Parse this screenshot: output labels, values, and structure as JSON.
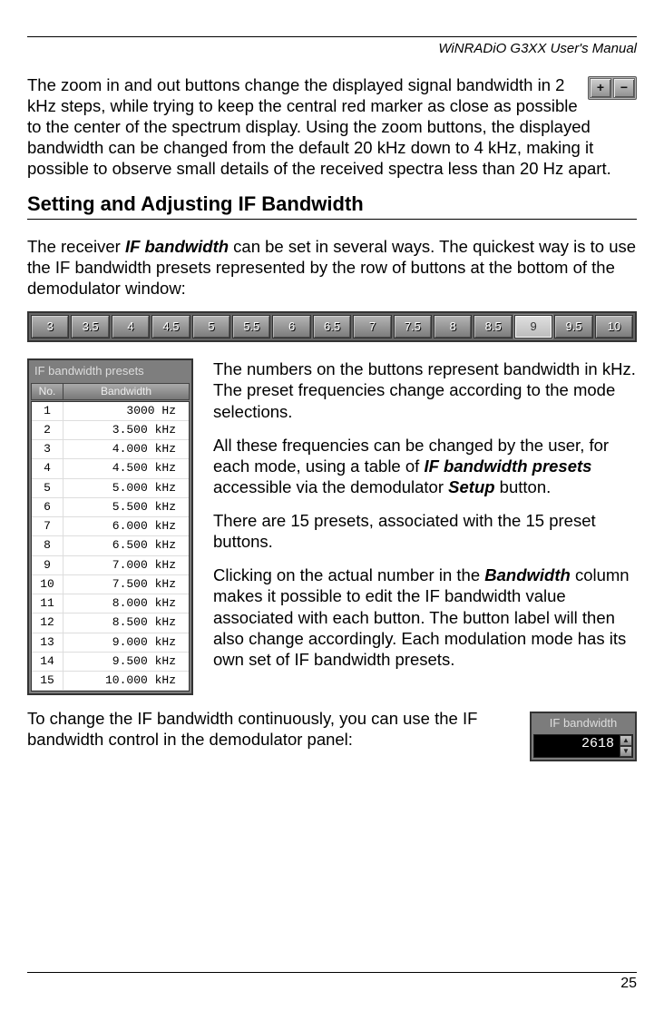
{
  "header": {
    "title": "WiNRADiO G3XX User's Manual"
  },
  "zoom": {
    "plus": "+",
    "minus": "−"
  },
  "p1": "The zoom in and out buttons change the displayed signal bandwidth in 2 kHz steps, while trying to keep the central red marker as close as possible to the center of the spectrum display. Using the zoom buttons, the displayed bandwidth can be changed from the default 20 kHz down to 4 kHz, making it possible to observe small details of the received spectra less than 20 Hz apart.",
  "section_heading": "Setting and Adjusting IF Bandwidth",
  "p2a": "The receiver ",
  "p2b": "IF bandwidth",
  "p2c": " can be set in several ways. The quickest way is to use the IF bandwidth presets represented by the row of buttons at the bottom of the demodulator window:",
  "bw_buttons": [
    "3",
    "3.5",
    "4",
    "4.5",
    "5",
    "5.5",
    "6",
    "6.5",
    "7",
    "7.5",
    "8",
    "8.5",
    "9",
    "9.5",
    "10"
  ],
  "bw_selected_index": 12,
  "presets": {
    "title": "IF bandwidth presets",
    "col_no": "No.",
    "col_bw": "Bandwidth",
    "rows": [
      {
        "no": "1",
        "bw": "3000 Hz"
      },
      {
        "no": "2",
        "bw": "3.500 kHz"
      },
      {
        "no": "3",
        "bw": "4.000 kHz"
      },
      {
        "no": "4",
        "bw": "4.500 kHz"
      },
      {
        "no": "5",
        "bw": "5.000 kHz"
      },
      {
        "no": "6",
        "bw": "5.500 kHz"
      },
      {
        "no": "7",
        "bw": "6.000 kHz"
      },
      {
        "no": "8",
        "bw": "6.500 kHz"
      },
      {
        "no": "9",
        "bw": "7.000 kHz"
      },
      {
        "no": "10",
        "bw": "7.500 kHz"
      },
      {
        "no": "11",
        "bw": "8.000 kHz"
      },
      {
        "no": "12",
        "bw": "8.500 kHz"
      },
      {
        "no": "13",
        "bw": "9.000 kHz"
      },
      {
        "no": "14",
        "bw": "9.500 kHz"
      },
      {
        "no": "15",
        "bw": "10.000 kHz"
      }
    ]
  },
  "p3": "The numbers on the buttons represent bandwidth in kHz. The preset frequencies change according to the mode selections.",
  "p4a": "All these frequencies can be changed by the user, for each mode, using a table of ",
  "p4b": "IF bandwidth presets",
  "p4c": " accessible via the demodulator ",
  "p4d": "Setup",
  "p4e": " button.",
  "p5": "There are 15 presets, associated with the 15 preset buttons.",
  "p6a": "Clicking on the actual number in the ",
  "p6b": "Bandwidth",
  "p6c": " column makes it possible to edit the IF bandwidth value associated with each button. The button label will then also change accordingly. Each modulation mode has its own set of IF bandwidth presets.",
  "p7": "To change the IF bandwidth continuously, you can use the IF bandwidth control in the demodulator panel:",
  "if_ctrl": {
    "label": "IF bandwidth",
    "value": "2618"
  },
  "page_number": "25"
}
